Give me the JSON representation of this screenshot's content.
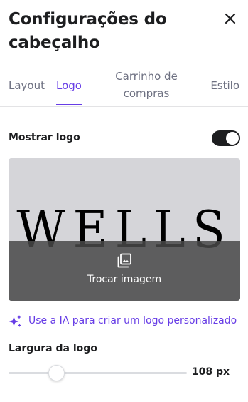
{
  "header": {
    "title": "Configurações do cabeçalho",
    "close_icon": "close-icon"
  },
  "tabs": [
    {
      "label": "Layout",
      "active": false
    },
    {
      "label": "Logo",
      "active": true
    },
    {
      "label": "Carrinho de compras",
      "active": false
    },
    {
      "label": "Estilo",
      "active": false
    }
  ],
  "logo_section": {
    "show_logo_label": "Mostrar logo",
    "show_logo_enabled": true,
    "logo_image_text": "WELLS",
    "change_image_label": "Trocar imagem",
    "change_image_icon": "image-gallery-icon"
  },
  "ai_link": {
    "label": "Use a IA para criar um logo personalizado",
    "icon": "sparkles-icon"
  },
  "logo_width": {
    "label": "Largura da logo",
    "value_text": "108 px",
    "value_fraction": 0.27
  },
  "colors": {
    "accent": "#673de6",
    "text": "#1d1e20",
    "muted": "#6d7081",
    "toggle_on": "#1d1e20"
  }
}
